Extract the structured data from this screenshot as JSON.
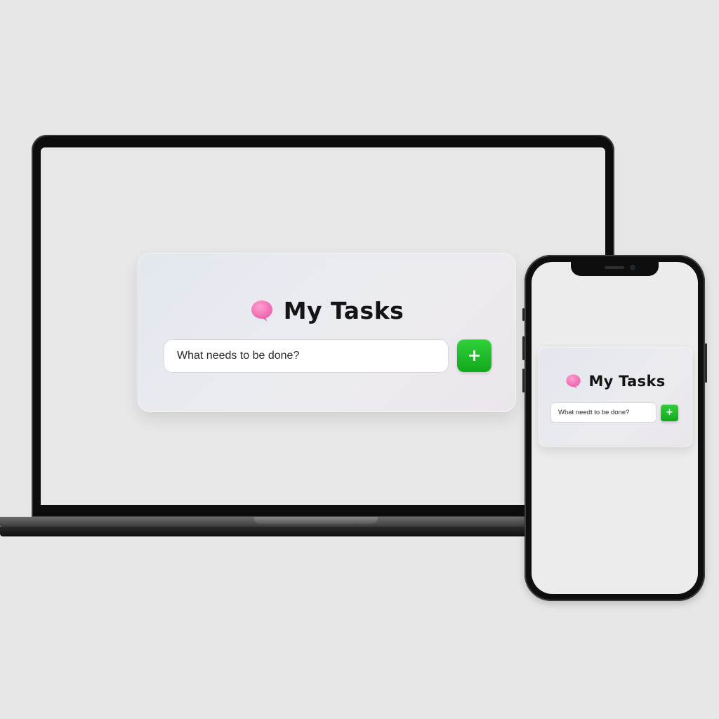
{
  "laptop_app": {
    "title": "My Tasks",
    "icon": "speech-bubble-icon",
    "input_placeholder": "What needs to be done?",
    "add_button_label": "+"
  },
  "phone_app": {
    "title": "My Tasks",
    "icon": "speech-bubble-icon",
    "input_placeholder": "What needt to be done?",
    "add_button_label": "+"
  },
  "colors": {
    "background": "#e6e6e6",
    "accent_add_button": "#1fbf2a",
    "icon_pink": "#f277b8",
    "title_text": "#141414"
  }
}
